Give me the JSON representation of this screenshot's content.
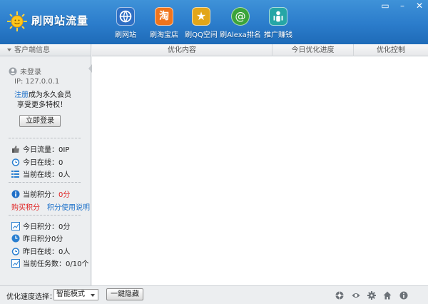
{
  "app": {
    "title": "刷网站流量"
  },
  "toolbar": {
    "items": [
      {
        "label": "刷网站",
        "icon": "globe-icon",
        "color": "#2f6fc4"
      },
      {
        "label": "刷淘宝店",
        "icon": "taobao-icon",
        "color": "#f0741c"
      },
      {
        "label": "刷QQ空间",
        "icon": "star-icon",
        "color": "#e2a61a"
      },
      {
        "label": "刷Alexa排名",
        "icon": "at-icon",
        "color": "#3ba43b"
      },
      {
        "label": "推广赚钱",
        "icon": "person-icon",
        "color": "#26a6a6"
      }
    ]
  },
  "window_controls": {
    "skin": "▭",
    "minimize": "–",
    "close": "✕"
  },
  "sidebar": {
    "header": "客户端信息",
    "user_status": "未登录",
    "ip": "IP: 127.0.0.1",
    "register_link": "注册",
    "register_text": "成为永久会员",
    "privileges": "享受更多特权！",
    "login_button": "立即登录",
    "stats": {
      "today_traffic": "今日流量：0IP",
      "today_online": "今日在线：0",
      "current_online": "当前在线：0人"
    },
    "points": {
      "current_label": "当前积分：",
      "current_value": "0分",
      "buy_link": "购买积分",
      "help_link": "积分使用说明"
    },
    "history": {
      "today_points": "今日积分：0分",
      "yesterday_points": "昨日积分0分",
      "yesterday_online": "昨日在线：0人",
      "current_tasks": "当前任务数：0/10个"
    }
  },
  "table": {
    "columns": [
      "优化内容",
      "今日优化进度",
      "优化控制"
    ],
    "rows": []
  },
  "bottom": {
    "speed_label": "优化速度选择：",
    "speed_mode": "智能模式",
    "hide_button": "一鍵隐藏",
    "icons": [
      "network-icon",
      "eye-icon",
      "gear-icon",
      "home-icon",
      "info-icon"
    ]
  }
}
